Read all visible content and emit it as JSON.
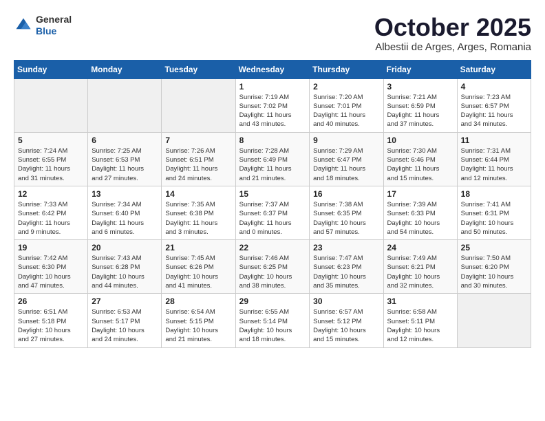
{
  "header": {
    "logo_general": "General",
    "logo_blue": "Blue",
    "title": "October 2025",
    "subtitle": "Albestii de Arges, Arges, Romania"
  },
  "weekdays": [
    "Sunday",
    "Monday",
    "Tuesday",
    "Wednesday",
    "Thursday",
    "Friday",
    "Saturday"
  ],
  "weeks": [
    [
      {
        "day": "",
        "info": ""
      },
      {
        "day": "",
        "info": ""
      },
      {
        "day": "",
        "info": ""
      },
      {
        "day": "1",
        "info": "Sunrise: 7:19 AM\nSunset: 7:02 PM\nDaylight: 11 hours\nand 43 minutes."
      },
      {
        "day": "2",
        "info": "Sunrise: 7:20 AM\nSunset: 7:01 PM\nDaylight: 11 hours\nand 40 minutes."
      },
      {
        "day": "3",
        "info": "Sunrise: 7:21 AM\nSunset: 6:59 PM\nDaylight: 11 hours\nand 37 minutes."
      },
      {
        "day": "4",
        "info": "Sunrise: 7:23 AM\nSunset: 6:57 PM\nDaylight: 11 hours\nand 34 minutes."
      }
    ],
    [
      {
        "day": "5",
        "info": "Sunrise: 7:24 AM\nSunset: 6:55 PM\nDaylight: 11 hours\nand 31 minutes."
      },
      {
        "day": "6",
        "info": "Sunrise: 7:25 AM\nSunset: 6:53 PM\nDaylight: 11 hours\nand 27 minutes."
      },
      {
        "day": "7",
        "info": "Sunrise: 7:26 AM\nSunset: 6:51 PM\nDaylight: 11 hours\nand 24 minutes."
      },
      {
        "day": "8",
        "info": "Sunrise: 7:28 AM\nSunset: 6:49 PM\nDaylight: 11 hours\nand 21 minutes."
      },
      {
        "day": "9",
        "info": "Sunrise: 7:29 AM\nSunset: 6:47 PM\nDaylight: 11 hours\nand 18 minutes."
      },
      {
        "day": "10",
        "info": "Sunrise: 7:30 AM\nSunset: 6:46 PM\nDaylight: 11 hours\nand 15 minutes."
      },
      {
        "day": "11",
        "info": "Sunrise: 7:31 AM\nSunset: 6:44 PM\nDaylight: 11 hours\nand 12 minutes."
      }
    ],
    [
      {
        "day": "12",
        "info": "Sunrise: 7:33 AM\nSunset: 6:42 PM\nDaylight: 11 hours\nand 9 minutes."
      },
      {
        "day": "13",
        "info": "Sunrise: 7:34 AM\nSunset: 6:40 PM\nDaylight: 11 hours\nand 6 minutes."
      },
      {
        "day": "14",
        "info": "Sunrise: 7:35 AM\nSunset: 6:38 PM\nDaylight: 11 hours\nand 3 minutes."
      },
      {
        "day": "15",
        "info": "Sunrise: 7:37 AM\nSunset: 6:37 PM\nDaylight: 11 hours\nand 0 minutes."
      },
      {
        "day": "16",
        "info": "Sunrise: 7:38 AM\nSunset: 6:35 PM\nDaylight: 10 hours\nand 57 minutes."
      },
      {
        "day": "17",
        "info": "Sunrise: 7:39 AM\nSunset: 6:33 PM\nDaylight: 10 hours\nand 54 minutes."
      },
      {
        "day": "18",
        "info": "Sunrise: 7:41 AM\nSunset: 6:31 PM\nDaylight: 10 hours\nand 50 minutes."
      }
    ],
    [
      {
        "day": "19",
        "info": "Sunrise: 7:42 AM\nSunset: 6:30 PM\nDaylight: 10 hours\nand 47 minutes."
      },
      {
        "day": "20",
        "info": "Sunrise: 7:43 AM\nSunset: 6:28 PM\nDaylight: 10 hours\nand 44 minutes."
      },
      {
        "day": "21",
        "info": "Sunrise: 7:45 AM\nSunset: 6:26 PM\nDaylight: 10 hours\nand 41 minutes."
      },
      {
        "day": "22",
        "info": "Sunrise: 7:46 AM\nSunset: 6:25 PM\nDaylight: 10 hours\nand 38 minutes."
      },
      {
        "day": "23",
        "info": "Sunrise: 7:47 AM\nSunset: 6:23 PM\nDaylight: 10 hours\nand 35 minutes."
      },
      {
        "day": "24",
        "info": "Sunrise: 7:49 AM\nSunset: 6:21 PM\nDaylight: 10 hours\nand 32 minutes."
      },
      {
        "day": "25",
        "info": "Sunrise: 7:50 AM\nSunset: 6:20 PM\nDaylight: 10 hours\nand 30 minutes."
      }
    ],
    [
      {
        "day": "26",
        "info": "Sunrise: 6:51 AM\nSunset: 5:18 PM\nDaylight: 10 hours\nand 27 minutes."
      },
      {
        "day": "27",
        "info": "Sunrise: 6:53 AM\nSunset: 5:17 PM\nDaylight: 10 hours\nand 24 minutes."
      },
      {
        "day": "28",
        "info": "Sunrise: 6:54 AM\nSunset: 5:15 PM\nDaylight: 10 hours\nand 21 minutes."
      },
      {
        "day": "29",
        "info": "Sunrise: 6:55 AM\nSunset: 5:14 PM\nDaylight: 10 hours\nand 18 minutes."
      },
      {
        "day": "30",
        "info": "Sunrise: 6:57 AM\nSunset: 5:12 PM\nDaylight: 10 hours\nand 15 minutes."
      },
      {
        "day": "31",
        "info": "Sunrise: 6:58 AM\nSunset: 5:11 PM\nDaylight: 10 hours\nand 12 minutes."
      },
      {
        "day": "",
        "info": ""
      }
    ]
  ]
}
